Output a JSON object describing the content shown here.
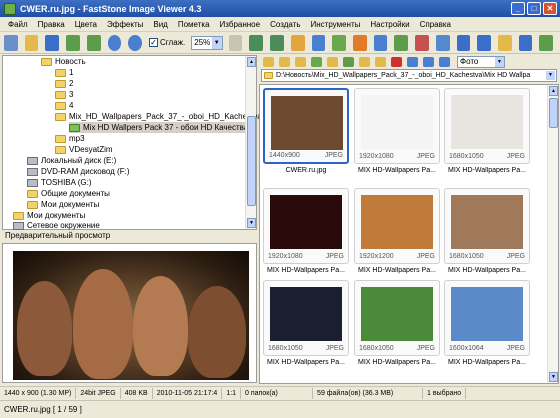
{
  "window": {
    "title": "CWER.ru.jpg  -  FastStone Image Viewer 4.3",
    "min": "_",
    "max": "□",
    "close": "✕"
  },
  "menu": [
    "Файл",
    "Правка",
    "Цвета",
    "Эффекты",
    "Вид",
    "Пометка",
    "Избранное",
    "Создать",
    "Инструменты",
    "Настройки",
    "Справка"
  ],
  "toolbar": {
    "smooth_label": "Сглаж.",
    "smooth_checked": "✓",
    "zoom_value": "25%",
    "dropdown_arrow": "▼"
  },
  "tree": [
    {
      "label": "Новость",
      "type": "folder"
    },
    {
      "label": "1",
      "type": "folder"
    },
    {
      "label": "2",
      "type": "folder"
    },
    {
      "label": "3",
      "type": "folder"
    },
    {
      "label": "4",
      "type": "folder"
    },
    {
      "label": "Mix_HD_Wallpapers_Pack_37_-_oboi_HD_Kachestva",
      "type": "folder"
    },
    {
      "label": "Mix HD Wallpers Pack 37 - обои HD Качества",
      "type": "folder"
    },
    {
      "label": "mp3",
      "type": "folder"
    },
    {
      "label": "VDesyatZim",
      "type": "folder"
    },
    {
      "label": "Локальный диск (E:)",
      "type": "drive"
    },
    {
      "label": "DVD-RAM дисковод (F:)",
      "type": "drive"
    },
    {
      "label": "TOSHIBA (G:)",
      "type": "drive"
    },
    {
      "label": "Общие документы",
      "type": "folder"
    },
    {
      "label": "Мои документы",
      "type": "folder"
    },
    {
      "label": "Мои документы",
      "type": "folder"
    },
    {
      "label": "Сетевое окружение",
      "type": "drive"
    }
  ],
  "preview": {
    "title": "Предварительный просмотр"
  },
  "sort": {
    "value": "Фото"
  },
  "address": {
    "path": "D:\\Новость\\Mix_HD_Wallpapers_Pack_37_-_oboi_HD_Kachestva\\Mix HD Wallpa"
  },
  "thumbnails": [
    {
      "dim": "1440x900",
      "fmt": "JPEG",
      "caption": "CWER.ru.jpg",
      "color": "#6b4a30"
    },
    {
      "dim": "1920x1080",
      "fmt": "JPEG",
      "caption": "MIX HD-Wallpapers Pa...",
      "color": "#f4f4f4"
    },
    {
      "dim": "1680x1050",
      "fmt": "JPEG",
      "caption": "MIX HD-Wallpapers Pa...",
      "color": "#e8e4e0"
    },
    {
      "dim": "1920x1080",
      "fmt": "JPEG",
      "caption": "MIX HD-Wallpapers Pa...",
      "color": "#2a0a0a"
    },
    {
      "dim": "1920x1200",
      "fmt": "JPEG",
      "caption": "MIX HD-Wallpapers Pa...",
      "color": "#c07a3a"
    },
    {
      "dim": "1680x1050",
      "fmt": "JPEG",
      "caption": "MIX HD-Wallpapers Pa...",
      "color": "#a0785a"
    },
    {
      "dim": "1680x1050",
      "fmt": "JPEG",
      "caption": "MIX HD-Wallpapers Pa...",
      "color": "#1a2030"
    },
    {
      "dim": "1680x1050",
      "fmt": "JPEG",
      "caption": "MIX HD-Wallpapers Pa...",
      "color": "#4a8a3a"
    },
    {
      "dim": "1600x1064",
      "fmt": "JPEG",
      "caption": "MIX HD-Wallpapers Pa...",
      "color": "#5a8ac8"
    }
  ],
  "status": {
    "dims": "1440 x 900 (1.30 MP)",
    "color": "24bit JPEG",
    "size": "408 KB",
    "date": "2010-11-05 21:17:4",
    "ratio": "1:1",
    "selected_folders": "0 папок(а)",
    "files": "59 файла(ов) (36.3 MB)",
    "selected": "1 выбрано",
    "file_index": "CWER.ru.jpg [ 1 / 59 ]"
  }
}
